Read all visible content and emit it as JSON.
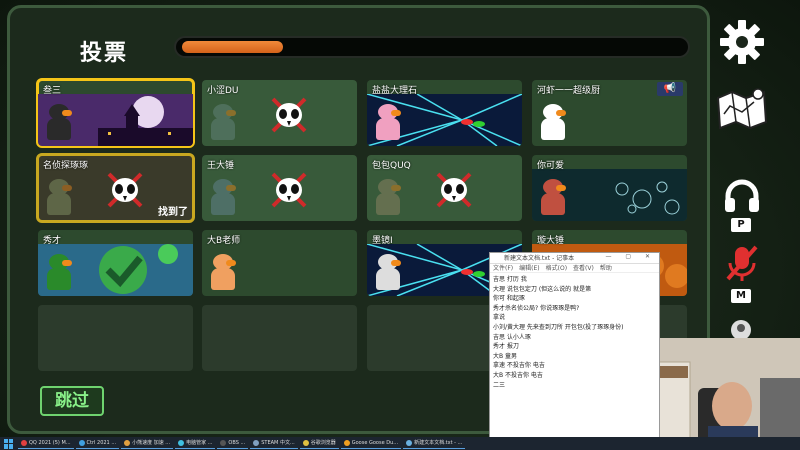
{
  "window": {
    "title": "投票"
  },
  "timer": {
    "progress": 0.2
  },
  "skip_label": "跳过",
  "found_label": "找到了",
  "players": [
    {
      "name": "叁三",
      "state": "selected",
      "bg": "night",
      "avatar": "#2a2a2a"
    },
    {
      "name": "小涩DU",
      "state": "dead",
      "avatar": "#6a8a86"
    },
    {
      "name": "盐盐大理石",
      "state": "alive",
      "bg": "warp",
      "avatar": "#f0a0c0"
    },
    {
      "name": "河虾一一超级厨",
      "state": "alive",
      "bg": "plain",
      "avatar": "#ffffff",
      "megaphone": true
    },
    {
      "name": "名侦探琢琢",
      "state": "dead-found",
      "avatar": "#8a9c6a"
    },
    {
      "name": "王大锤",
      "state": "dead",
      "avatar": "#6a8a9c"
    },
    {
      "name": "包包QUQ",
      "state": "dead",
      "avatar": "#9a8a6a"
    },
    {
      "name": "你可爱",
      "state": "alive",
      "bg": "bubbles",
      "avatar": "#c05040"
    },
    {
      "name": "秀才",
      "state": "alive",
      "bg": "check",
      "avatar": "#2a8a2a"
    },
    {
      "name": "大B老师",
      "state": "alive",
      "bg": "plain",
      "avatar": "#f0a060"
    },
    {
      "name": "墨镜I",
      "state": "alive",
      "bg": "warp",
      "avatar": "#dddddd"
    },
    {
      "name": "璇大锤",
      "state": "alive",
      "bg": "pumpkin",
      "avatar": "#c06030"
    },
    {
      "name": "",
      "state": "empty"
    },
    {
      "name": "",
      "state": "empty"
    },
    {
      "name": "",
      "state": "empty"
    },
    {
      "name": "",
      "state": "empty"
    }
  ],
  "right_icons": [
    "gear-icon",
    "map-icon",
    "headphones-icon",
    "mic-muted-icon",
    "person-icon"
  ],
  "key_labels": {
    "voice": "P",
    "mute": "M"
  },
  "notepad": {
    "title": "新建文本文档.txt - 记事本",
    "menu": [
      "文件(F)",
      "编辑(E)",
      "格式(O)",
      "查看(V)",
      "帮助"
    ],
    "lines": [
      "吉思 打历 我",
      "大理 说包包定刀 (但这么说的 就是第",
      "你可 和起琢",
      "秀才杀名侦公局? 你说琢琢是鸭?",
      "拿说",
      "小刘/黄大理 先来查到刀所 开包包(投了琢琢身份)",
      "吉思 认小人琢",
      "秀才 报刀",
      "大B 童男",
      "拿速 不投吉你 电吉",
      "大B 不投吉你 电吉",
      "二三"
    ]
  },
  "taskbar": {
    "items": [
      "QQ 2021 (5) M...",
      "Ctrl 2021 ...",
      "小熊速度 加速 ...",
      "电脑管家 ...",
      "OBS ...",
      "STEAM 中文...",
      "谷歌浏览器",
      "Goose Goose Du...",
      "新建文本文档.txt - ..."
    ]
  }
}
